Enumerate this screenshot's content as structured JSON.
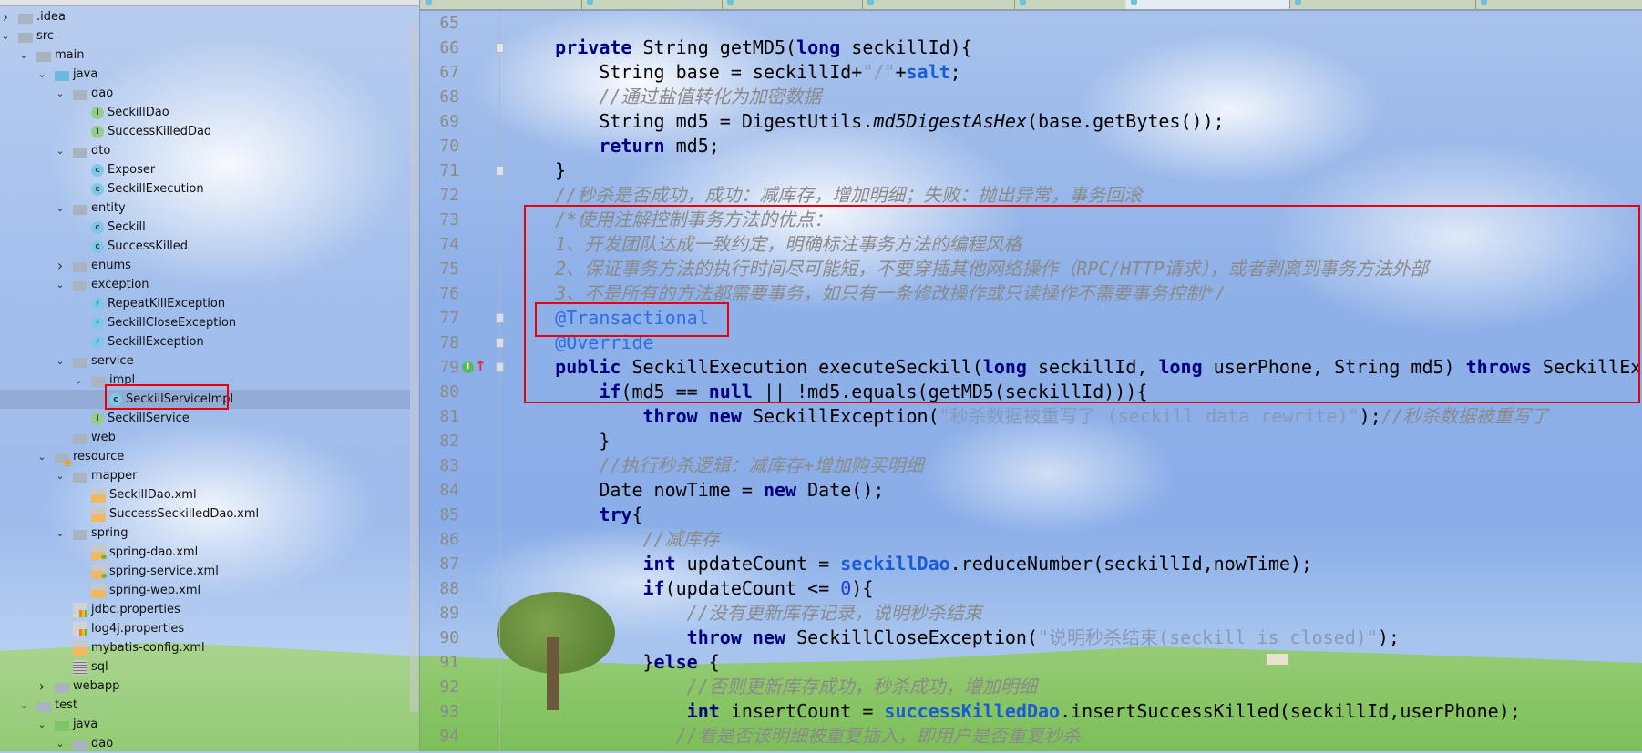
{
  "colors": {
    "keyword": "#000080",
    "annotation": "#2a6ee8",
    "comment": "#8a8a8a",
    "string": "#8899b8",
    "field": "#1a5bd6",
    "highlight_box": "#e8000b"
  },
  "project_tree": [
    {
      "depth": 0,
      "label": ".idea",
      "icon": "folder",
      "arrow": "collapsed"
    },
    {
      "depth": 0,
      "label": "src",
      "icon": "folder",
      "arrow": "expanded"
    },
    {
      "depth": 1,
      "label": "main",
      "icon": "folder",
      "arrow": "expanded"
    },
    {
      "depth": 2,
      "label": "java",
      "icon": "java-folder",
      "arrow": "expanded"
    },
    {
      "depth": 3,
      "label": "dao",
      "icon": "folder",
      "arrow": "expanded"
    },
    {
      "depth": 4,
      "label": "SeckillDao",
      "icon": "interface",
      "arrow": "none"
    },
    {
      "depth": 4,
      "label": "SuccessKilledDao",
      "icon": "interface",
      "arrow": "none"
    },
    {
      "depth": 3,
      "label": "dto",
      "icon": "folder",
      "arrow": "expanded"
    },
    {
      "depth": 4,
      "label": "Exposer",
      "icon": "class",
      "arrow": "none"
    },
    {
      "depth": 4,
      "label": "SeckillExecution",
      "icon": "class",
      "arrow": "none"
    },
    {
      "depth": 3,
      "label": "entity",
      "icon": "folder",
      "arrow": "expanded"
    },
    {
      "depth": 4,
      "label": "Seckill",
      "icon": "class",
      "arrow": "none"
    },
    {
      "depth": 4,
      "label": "SuccessKilled",
      "icon": "class",
      "arrow": "none"
    },
    {
      "depth": 3,
      "label": "enums",
      "icon": "folder",
      "arrow": "collapsed"
    },
    {
      "depth": 3,
      "label": "exception",
      "icon": "folder",
      "arrow": "expanded"
    },
    {
      "depth": 4,
      "label": "RepeatKillException",
      "icon": "exception",
      "arrow": "none"
    },
    {
      "depth": 4,
      "label": "SeckillCloseException",
      "icon": "exception",
      "arrow": "none"
    },
    {
      "depth": 4,
      "label": "SeckillException",
      "icon": "exception",
      "arrow": "none"
    },
    {
      "depth": 3,
      "label": "service",
      "icon": "folder",
      "arrow": "expanded"
    },
    {
      "depth": 4,
      "label": "impl",
      "icon": "folder",
      "arrow": "expanded"
    },
    {
      "depth": 5,
      "label": "SeckillServiceImpl",
      "icon": "class",
      "arrow": "none",
      "selected": true
    },
    {
      "depth": 4,
      "label": "SeckillService",
      "icon": "interface",
      "arrow": "none"
    },
    {
      "depth": 3,
      "label": "web",
      "icon": "folder",
      "arrow": "none"
    },
    {
      "depth": 2,
      "label": "resource",
      "icon": "resource-folder",
      "arrow": "expanded"
    },
    {
      "depth": 3,
      "label": "mapper",
      "icon": "folder",
      "arrow": "expanded"
    },
    {
      "depth": 4,
      "label": "SeckillDao.xml",
      "icon": "xml",
      "arrow": "none"
    },
    {
      "depth": 4,
      "label": "SuccessSeckilledDao.xml",
      "icon": "xml",
      "arrow": "none"
    },
    {
      "depth": 3,
      "label": "spring",
      "icon": "folder",
      "arrow": "expanded"
    },
    {
      "depth": 4,
      "label": "spring-dao.xml",
      "icon": "spring-xml",
      "arrow": "none"
    },
    {
      "depth": 4,
      "label": "spring-service.xml",
      "icon": "spring-xml",
      "arrow": "none"
    },
    {
      "depth": 4,
      "label": "spring-web.xml",
      "icon": "xml",
      "arrow": "none"
    },
    {
      "depth": 3,
      "label": "jdbc.properties",
      "icon": "properties",
      "arrow": "none"
    },
    {
      "depth": 3,
      "label": "log4j.properties",
      "icon": "properties",
      "arrow": "none"
    },
    {
      "depth": 3,
      "label": "mybatis-config.xml",
      "icon": "xml",
      "arrow": "none"
    },
    {
      "depth": 3,
      "label": "sql",
      "icon": "sql",
      "arrow": "none"
    },
    {
      "depth": 2,
      "label": "webapp",
      "icon": "folder",
      "arrow": "collapsed"
    },
    {
      "depth": 1,
      "label": "test",
      "icon": "folder",
      "arrow": "expanded"
    },
    {
      "depth": 2,
      "label": "java",
      "icon": "test-folder",
      "arrow": "expanded"
    },
    {
      "depth": 3,
      "label": "dao",
      "icon": "folder",
      "arrow": "expanded"
    }
  ],
  "editor": {
    "active_tab_index": 5,
    "lines": [
      {
        "n": "65",
        "tokens": []
      },
      {
        "n": "66",
        "fold": true,
        "tokens": [
          [
            "t",
            "    "
          ],
          [
            "k",
            "private"
          ],
          [
            "t",
            " String getMD5("
          ],
          [
            "k",
            "long"
          ],
          [
            "t",
            " seckillId){"
          ]
        ]
      },
      {
        "n": "67",
        "tokens": [
          [
            "t",
            "        String base = seckillId+"
          ],
          [
            "s",
            "\"/\""
          ],
          [
            "t",
            "+"
          ],
          [
            "f",
            "salt"
          ],
          [
            "t",
            ";"
          ]
        ]
      },
      {
        "n": "68",
        "tokens": [
          [
            "c",
            "        //通过盐值转化为加密数据"
          ]
        ]
      },
      {
        "n": "69",
        "tokens": [
          [
            "t",
            "        String md5 = DigestUtils."
          ],
          [
            "m",
            "md5DigestAsHex"
          ],
          [
            "t",
            "(base.getBytes());"
          ]
        ]
      },
      {
        "n": "70",
        "tokens": [
          [
            "t",
            "        "
          ],
          [
            "k",
            "return"
          ],
          [
            "t",
            " md5;"
          ]
        ]
      },
      {
        "n": "71",
        "fold": true,
        "tokens": [
          [
            "t",
            "    }"
          ]
        ]
      },
      {
        "n": "72",
        "tokens": [
          [
            "c",
            "    //秒杀是否成功，成功：减库存，增加明细；失败：抛出异常，事务回滚"
          ]
        ]
      },
      {
        "n": "73",
        "tokens": [
          [
            "c",
            "    /*使用注解控制事务方法的优点："
          ]
        ]
      },
      {
        "n": "74",
        "tokens": [
          [
            "c",
            "    1、开发团队达成一致约定，明确标注事务方法的编程风格"
          ]
        ]
      },
      {
        "n": "75",
        "tokens": [
          [
            "c",
            "    2、保证事务方法的执行时间尽可能短，不要穿插其他网络操作（RPC/HTTP请求），或者剥离到事务方法外部"
          ]
        ]
      },
      {
        "n": "76",
        "tokens": [
          [
            "c",
            "    3、不是所有的方法都需要事务，如只有一条修改操作或只读操作不需要事务控制*/"
          ]
        ]
      },
      {
        "n": "77",
        "fold": true,
        "tokens": [
          [
            "a",
            "    @Transactional"
          ]
        ]
      },
      {
        "n": "78",
        "fold": true,
        "tokens": [
          [
            "a",
            "    @Override"
          ]
        ]
      },
      {
        "n": "79",
        "fold": true,
        "implements_marker": true,
        "tokens": [
          [
            "t",
            "    "
          ],
          [
            "k",
            "public"
          ],
          [
            "t",
            " SeckillExecution executeSeckill("
          ],
          [
            "k",
            "long"
          ],
          [
            "t",
            " seckillId, "
          ],
          [
            "k",
            "long"
          ],
          [
            "t",
            " userPhone, String md5) "
          ],
          [
            "k",
            "throws"
          ],
          [
            "t",
            " SeckillExc"
          ]
        ]
      },
      {
        "n": "80",
        "tokens": [
          [
            "t",
            "        "
          ],
          [
            "k",
            "if"
          ],
          [
            "t",
            "(md5 == "
          ],
          [
            "k",
            "null"
          ],
          [
            "t",
            " || !md5.equals(getMD5(seckillId))){"
          ]
        ]
      },
      {
        "n": "81",
        "tokens": [
          [
            "t",
            "            "
          ],
          [
            "k",
            "throw"
          ],
          [
            "t",
            " "
          ],
          [
            "k",
            "new"
          ],
          [
            "t",
            " SeckillException("
          ],
          [
            "s",
            "\"秒杀数据被重写了 (seckill data rewrite)\""
          ],
          [
            "t",
            ");"
          ],
          [
            "c",
            "//秒杀数据被重写了"
          ]
        ]
      },
      {
        "n": "82",
        "tokens": [
          [
            "t",
            "        }"
          ]
        ]
      },
      {
        "n": "83",
        "tokens": [
          [
            "c",
            "        //执行秒杀逻辑：减库存+增加购买明细"
          ]
        ]
      },
      {
        "n": "84",
        "tokens": [
          [
            "t",
            "        Date nowTime = "
          ],
          [
            "k",
            "new"
          ],
          [
            "t",
            " Date();"
          ]
        ]
      },
      {
        "n": "85",
        "tokens": [
          [
            "t",
            "        "
          ],
          [
            "k",
            "try"
          ],
          [
            "t",
            "{"
          ]
        ]
      },
      {
        "n": "86",
        "tokens": [
          [
            "c",
            "            //减库存"
          ]
        ]
      },
      {
        "n": "87",
        "tokens": [
          [
            "t",
            "            "
          ],
          [
            "k",
            "int"
          ],
          [
            "t",
            " updateCount = "
          ],
          [
            "f",
            "seckillDao"
          ],
          [
            "t",
            ".reduceNumber(seckillId,nowTime);"
          ]
        ]
      },
      {
        "n": "88",
        "tokens": [
          [
            "t",
            "            "
          ],
          [
            "k",
            "if"
          ],
          [
            "t",
            "(updateCount <= "
          ],
          [
            "n",
            "0"
          ],
          [
            "t",
            "){"
          ]
        ]
      },
      {
        "n": "89",
        "tokens": [
          [
            "c",
            "                //没有更新库存记录，说明秒杀结束"
          ]
        ]
      },
      {
        "n": "90",
        "tokens": [
          [
            "t",
            "                "
          ],
          [
            "k",
            "throw"
          ],
          [
            "t",
            " "
          ],
          [
            "k",
            "new"
          ],
          [
            "t",
            " SeckillCloseException("
          ],
          [
            "s",
            "\"说明秒杀结束(seckill is closed)\""
          ],
          [
            "t",
            ");"
          ]
        ]
      },
      {
        "n": "91",
        "tokens": [
          [
            "t",
            "            }"
          ],
          [
            "k",
            "else"
          ],
          [
            "t",
            " {"
          ]
        ]
      },
      {
        "n": "92",
        "tokens": [
          [
            "c",
            "                //否则更新库存成功，秒杀成功，增加明细"
          ]
        ]
      },
      {
        "n": "93",
        "tokens": [
          [
            "t",
            "                "
          ],
          [
            "k",
            "int"
          ],
          [
            "t",
            " insertCount = "
          ],
          [
            "f",
            "successKilledDao"
          ],
          [
            "t",
            ".insertSuccessKilled(seckillId,userPhone);"
          ]
        ]
      },
      {
        "n": "94",
        "tokens": [
          [
            "c",
            "               //看是否该明细被重复插入，即用户是否重复秒杀"
          ]
        ]
      }
    ]
  }
}
